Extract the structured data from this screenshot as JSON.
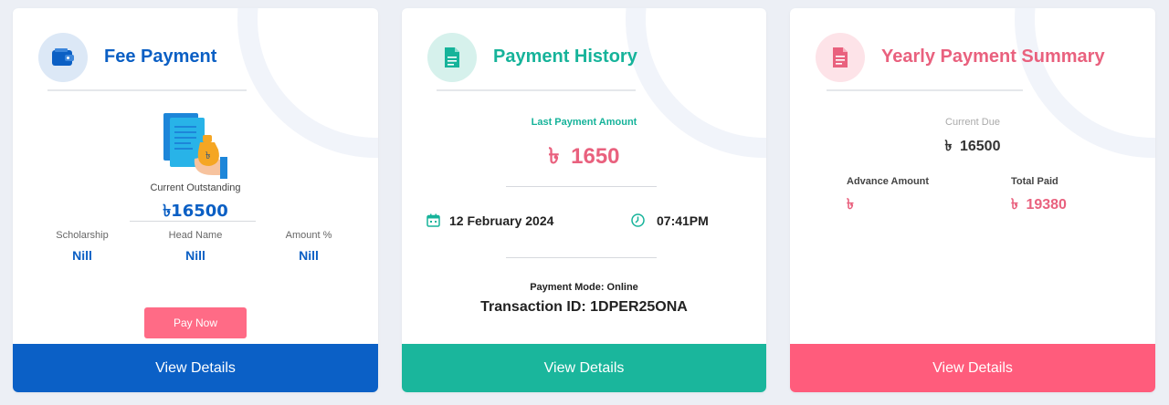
{
  "cards": {
    "fee": {
      "title": "Fee Payment",
      "outstanding_label": "Current Outstanding",
      "outstanding_value": "৳16500",
      "columns": [
        {
          "label": "Scholarship",
          "value": "Nill"
        },
        {
          "label": "Head Name",
          "value": "Nill"
        },
        {
          "label": "Amount %",
          "value": "Nill"
        }
      ],
      "pay_button": "Pay Now",
      "footer": "View Details",
      "color": "#0b5fc4",
      "footer_color": "#0b60c6"
    },
    "history": {
      "title": "Payment History",
      "last_amount_label": "Last Payment Amount",
      "currency": "৳",
      "last_amount_value": "1650",
      "date": "12 February 2024",
      "time": "07:41PM",
      "payment_mode": "Payment Mode: Online",
      "transaction": "Transaction ID: 1DPER25ONA",
      "footer": "View Details",
      "color": "#16b39a",
      "footer_color": "#1ab69c"
    },
    "yearly": {
      "title": "Yearly Payment Summary",
      "current_due_label": "Current Due",
      "currency": "৳",
      "current_due_value": "16500",
      "advance_label": "Advance Amount",
      "advance_value": "",
      "total_paid_label": "Total Paid",
      "total_paid_value": "19380",
      "footer": "View Details",
      "color": "#e9617e",
      "footer_color": "#ff5c7c"
    }
  }
}
